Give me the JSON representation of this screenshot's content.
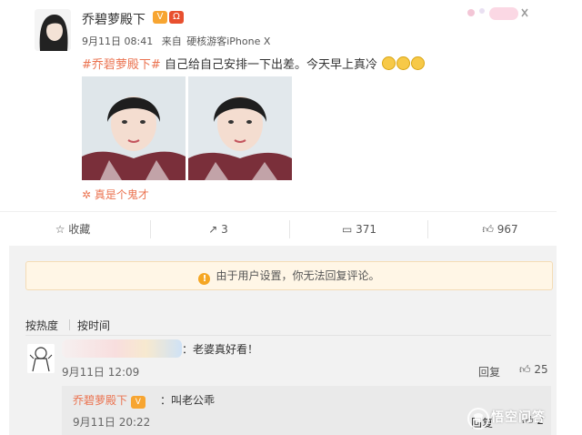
{
  "post": {
    "username": "乔碧萝殿下",
    "meta": {
      "time": "9月11日 08:41",
      "via": "来自",
      "source": "硬核游客iPhone X"
    },
    "hashtag": "#乔碧萝殿下#",
    "text": "自己给自己安排一下出差。今天早上真冷",
    "caption": "真是个鬼才"
  },
  "actions": {
    "collect_label": "收藏",
    "repost_count": "3",
    "comment_count": "371",
    "like_count": "967"
  },
  "comments": {
    "notice": "由于用户设置，你无法回复评论。",
    "sort": {
      "hot": "按热度",
      "time": "按时间"
    },
    "items": [
      {
        "text": "：老婆真好看！",
        "time": "9月11日 12:09",
        "reply_label": "回复",
        "likes": "25",
        "reply": {
          "author": "乔碧萝殿下",
          "text": "：叫老公乖",
          "time": "9月11日 20:22",
          "reply_label": "回复",
          "likes": "2"
        }
      }
    ]
  },
  "watermark": "悟空问答",
  "colors": {
    "accent": "#eb7350",
    "notice_bg": "#fff6e6",
    "panel_bg": "#f2f2f2"
  }
}
